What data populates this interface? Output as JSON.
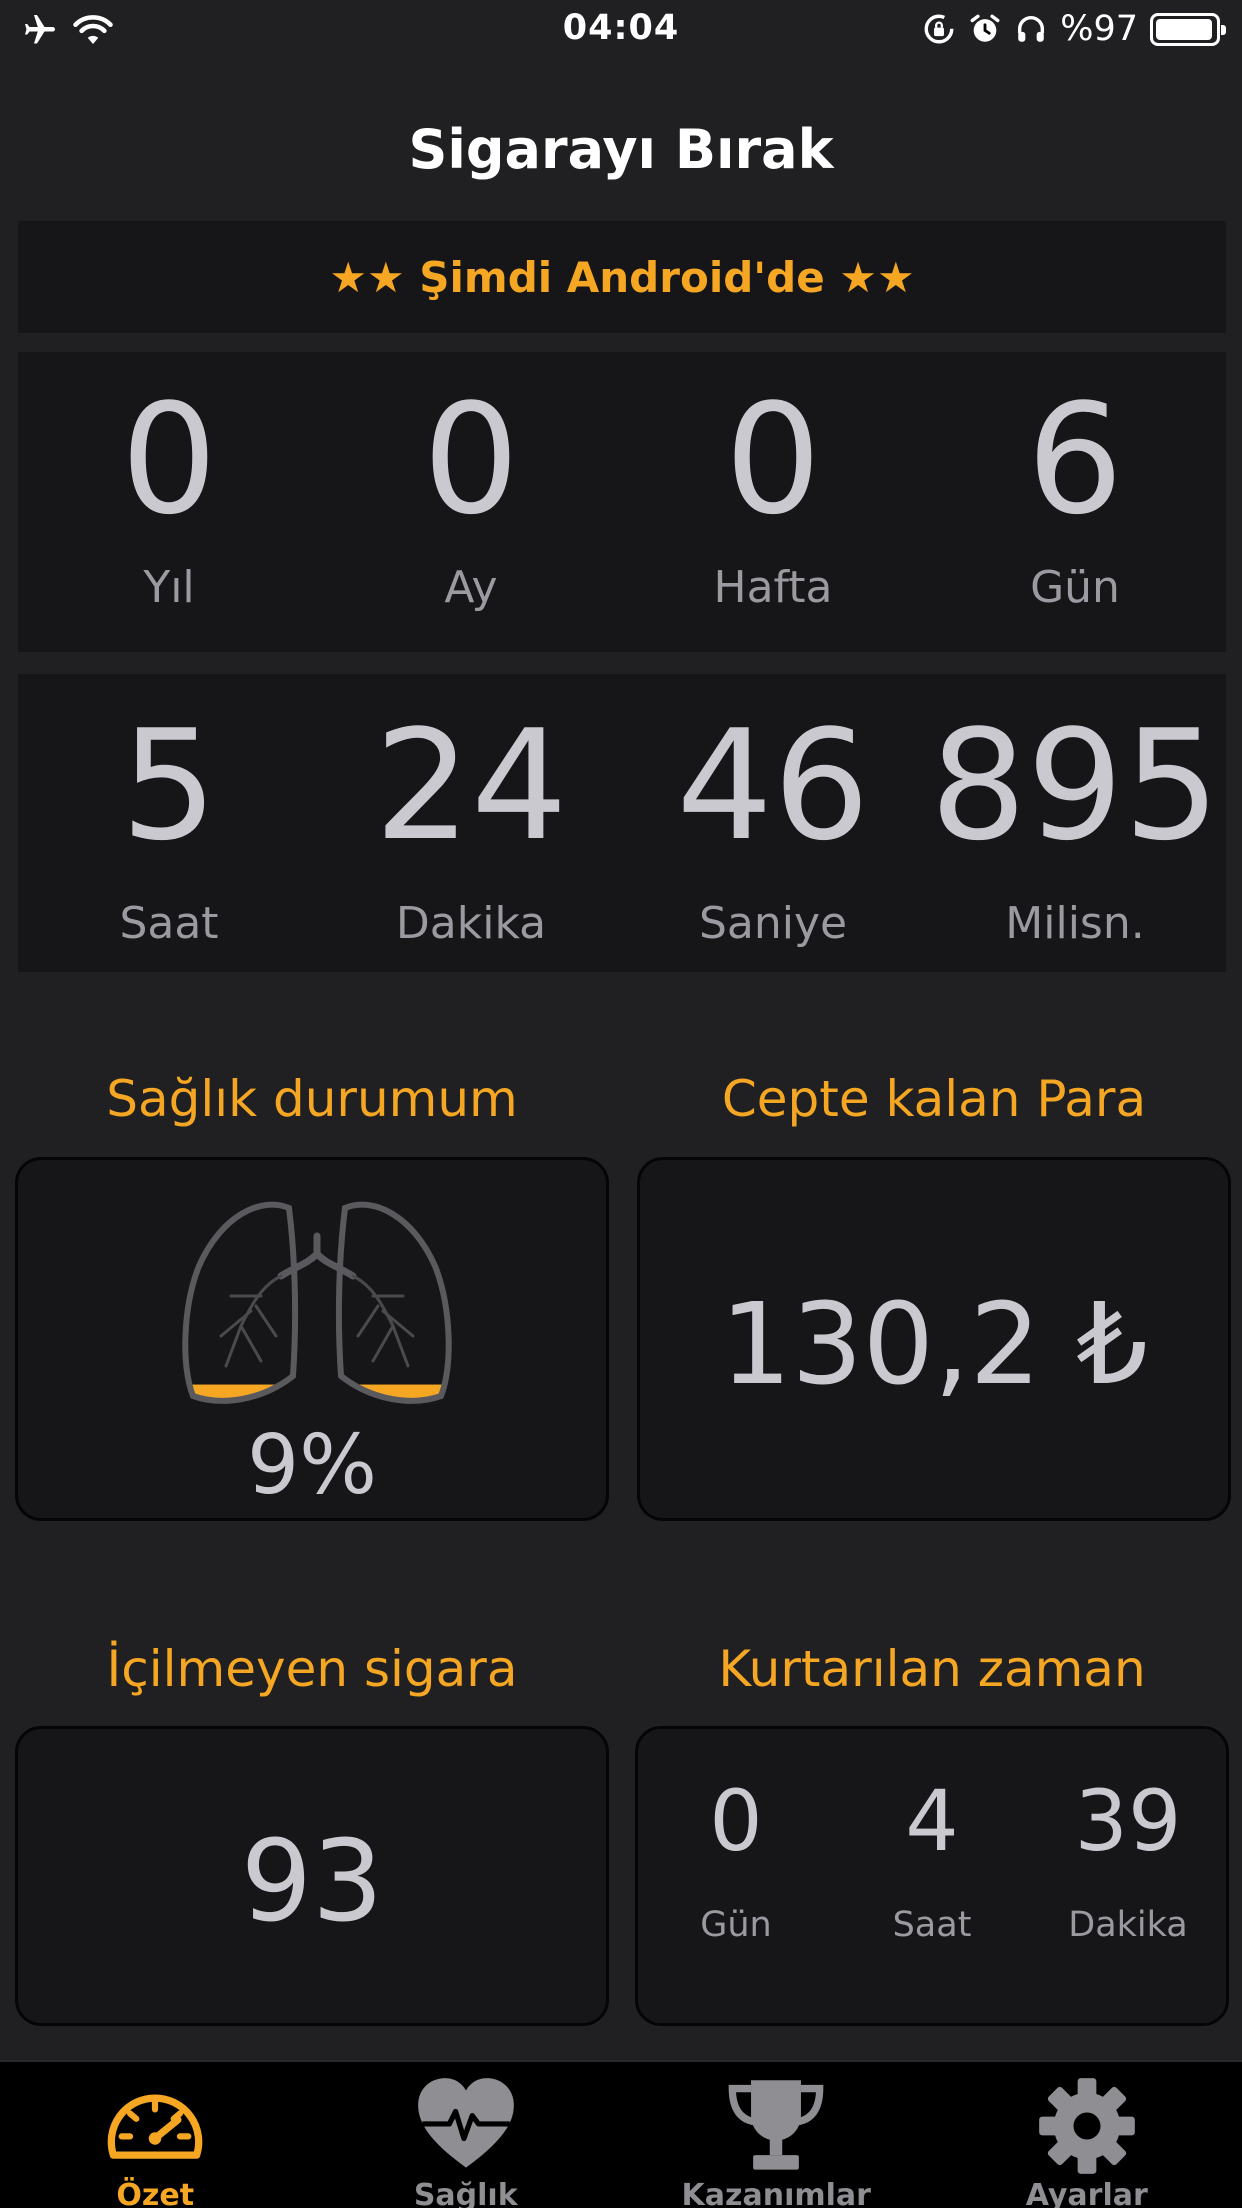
{
  "status_bar": {
    "time": "04:04",
    "battery_percent": "%97",
    "battery_level": 0.97,
    "left_icons": [
      "airplane-icon",
      "wifi-icon"
    ],
    "right_icons": [
      "rotation-lock-icon",
      "alarm-icon",
      "headphones-icon",
      "battery-icon"
    ]
  },
  "header": {
    "title": "Sigarayı Bırak"
  },
  "promo": {
    "text": "★★ Şimdi Android'de ★★"
  },
  "elapsed": {
    "top_row": [
      {
        "value": "0",
        "label": "Yıl"
      },
      {
        "value": "0",
        "label": "Ay"
      },
      {
        "value": "0",
        "label": "Hafta"
      },
      {
        "value": "6",
        "label": "Gün"
      }
    ],
    "bottom_row": [
      {
        "value": "5",
        "label": "Saat"
      },
      {
        "value": "24",
        "label": "Dakika"
      },
      {
        "value": "46",
        "label": "Saniye"
      },
      {
        "value": "895",
        "label": "Milisn."
      }
    ]
  },
  "health": {
    "title": "Sağlık durumum",
    "percent": "9%",
    "fill_fraction": 0.09,
    "icon": "lungs-icon"
  },
  "money": {
    "title": "Cepte kalan Para",
    "value": "130,2 ₺"
  },
  "cigarettes": {
    "title": "İçilmeyen sigara",
    "value": "93"
  },
  "time_saved": {
    "title": "Kurtarılan zaman",
    "items": [
      {
        "value": "0",
        "label": "Gün"
      },
      {
        "value": "4",
        "label": "Saat"
      },
      {
        "value": "39",
        "label": "Dakika"
      }
    ]
  },
  "tabs": [
    {
      "label": "Özet",
      "icon": "speedometer-icon",
      "active": true
    },
    {
      "label": "Sağlık",
      "icon": "heart-pulse-icon",
      "active": false
    },
    {
      "label": "Kazanımlar",
      "icon": "trophy-icon",
      "active": false
    },
    {
      "label": "Ayarlar",
      "icon": "gear-icon",
      "active": false
    }
  ],
  "colors": {
    "accent": "#f5a623",
    "background": "#202023",
    "panel": "#161618",
    "inactive": "#8e8e93"
  }
}
